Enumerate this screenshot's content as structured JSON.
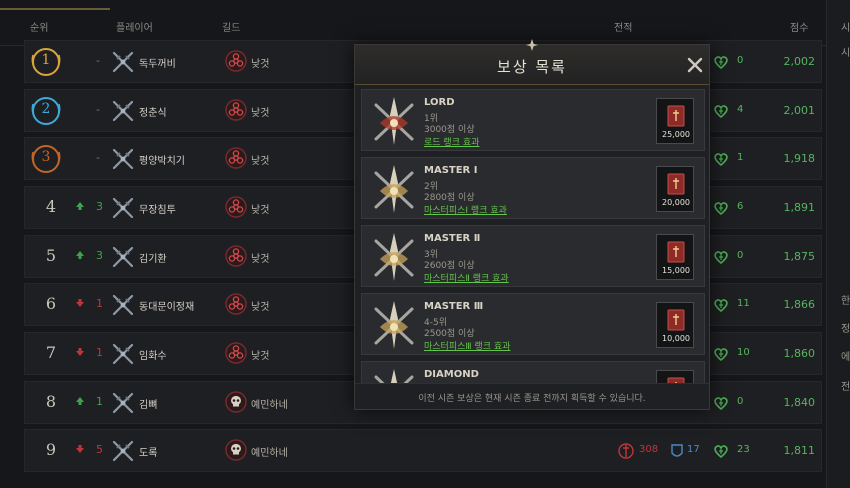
{
  "header": {
    "col_rank": "순위",
    "col_player": "플레이어",
    "col_guild": "길드",
    "col_record": "전적",
    "col_score": "점수",
    "right_partial": "시"
  },
  "right_sidebar": [
    "시",
    "한",
    "정",
    "에",
    "전"
  ],
  "rows": [
    {
      "rank": "1",
      "medal": "gold",
      "change_dir": "none",
      "change": "-",
      "name": "독두꺼비",
      "guild": "낮것",
      "guild_icon": "biohazard-icon",
      "wins": "0",
      "score": "2,002"
    },
    {
      "rank": "2",
      "medal": "blue",
      "change_dir": "none",
      "change": "-",
      "name": "정춘식",
      "guild": "낮것",
      "guild_icon": "biohazard-icon",
      "wins": "4",
      "score": "2,001"
    },
    {
      "rank": "3",
      "medal": "bronze",
      "change_dir": "none",
      "change": "-",
      "name": "평양박치기",
      "guild": "낮것",
      "guild_icon": "biohazard-icon",
      "wins": "1",
      "score": "1,918"
    },
    {
      "rank": "4",
      "medal": "",
      "change_dir": "up",
      "change": "3",
      "name": "무장침투",
      "guild": "낮것",
      "guild_icon": "biohazard-icon",
      "wins": "6",
      "score": "1,891"
    },
    {
      "rank": "5",
      "medal": "",
      "change_dir": "up",
      "change": "3",
      "name": "김기환",
      "guild": "낮것",
      "guild_icon": "biohazard-icon",
      "wins": "0",
      "score": "1,875"
    },
    {
      "rank": "6",
      "medal": "",
      "change_dir": "down",
      "change": "1",
      "name": "동대문이정재",
      "guild": "낮것",
      "guild_icon": "biohazard-icon",
      "wins": "11",
      "score": "1,866"
    },
    {
      "rank": "7",
      "medal": "",
      "change_dir": "down",
      "change": "1",
      "name": "임화수",
      "guild": "낮것",
      "guild_icon": "biohazard-icon",
      "wins": "10",
      "score": "1,860"
    },
    {
      "rank": "8",
      "medal": "",
      "change_dir": "up",
      "change": "1",
      "name": "김뼈",
      "guild": "예민하네",
      "guild_icon": "skull-icon",
      "wins": "0",
      "score": "1,840"
    },
    {
      "rank": "9",
      "medal": "",
      "change_dir": "down",
      "change": "5",
      "name": "도록",
      "guild": "예민하네",
      "guild_icon": "skull-icon",
      "atk": "308",
      "def": "17",
      "wins": "23",
      "score": "1,811"
    }
  ],
  "modal": {
    "title": "보상 목록",
    "footer": "이전 시즌 보상은 현재 시즌 종료 전까지 획득할 수 있습니다.",
    "rewards": [
      {
        "tier": "LORD",
        "place": "1위",
        "req": "3000점 이상",
        "effect": "로드 랭크 효과",
        "amount": "25,000"
      },
      {
        "tier": "MASTER Ⅰ",
        "place": "2위",
        "req": "2800점 이상",
        "effect": "마스터피스Ⅰ 랭크 효과",
        "amount": "20,000"
      },
      {
        "tier": "MASTER Ⅱ",
        "place": "3위",
        "req": "2600점 이상",
        "effect": "마스터피스Ⅱ 랭크 효과",
        "amount": "15,000"
      },
      {
        "tier": "MASTER Ⅲ",
        "place": "4-5위",
        "req": "2500점 이상",
        "effect": "마스터피스Ⅲ 랭크 효과",
        "amount": "10,000"
      },
      {
        "tier": "DIAMOND",
        "place": "",
        "req": "",
        "effect": "",
        "amount": ""
      }
    ]
  },
  "colors": {
    "gold": "#d9a53a",
    "blue": "#3fa9d6",
    "bronze": "#c2642a",
    "green": "#56b55e",
    "red": "#c0353a"
  }
}
